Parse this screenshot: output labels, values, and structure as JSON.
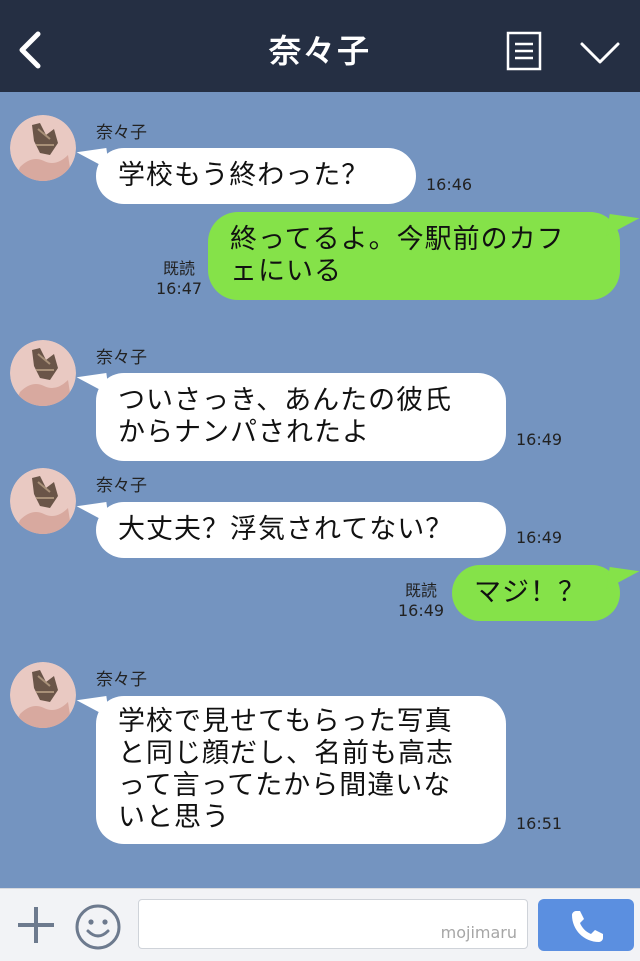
{
  "header": {
    "title": "奈々子",
    "back_icon": "chevron-left-icon",
    "menu_icon": "menu-list-icon",
    "collapse_icon": "chevron-down-icon",
    "background": "#252f43"
  },
  "colors": {
    "chat_background": "#7494c0",
    "incoming_bubble": "#ffffff",
    "outgoing_bubble": "#85e249"
  },
  "messages": [
    {
      "direction": "incoming",
      "sender": "奈々子",
      "text": "学校もう終わった？",
      "time": "16:46"
    },
    {
      "direction": "outgoing",
      "text": "終ってるよ。今駅前のカフ\nェにいる",
      "read": "既読",
      "time": "16:47"
    },
    {
      "direction": "incoming",
      "sender": "奈々子",
      "text": "ついさっき、あんたの彼氏\nからナンパされたよ",
      "time": "16:49"
    },
    {
      "direction": "incoming",
      "sender": "奈々子",
      "text": "大丈夫？浮気されてない？",
      "time": "16:49"
    },
    {
      "direction": "outgoing",
      "text": "マジ！？",
      "read": "既読",
      "time": "16:49"
    },
    {
      "direction": "incoming",
      "sender": "奈々子",
      "text": "学校で見せてもらった写真\nと同じ顔だし、名前も高志\nって言ってたから間違いな\nいと思う",
      "time": "16:51"
    }
  ],
  "footer": {
    "plus_icon": "plus-icon",
    "emoji_icon": "smiley-icon",
    "input_value": "",
    "watermark": "mojimaru",
    "call_icon": "phone-icon",
    "call_color": "#5b8fe0"
  }
}
